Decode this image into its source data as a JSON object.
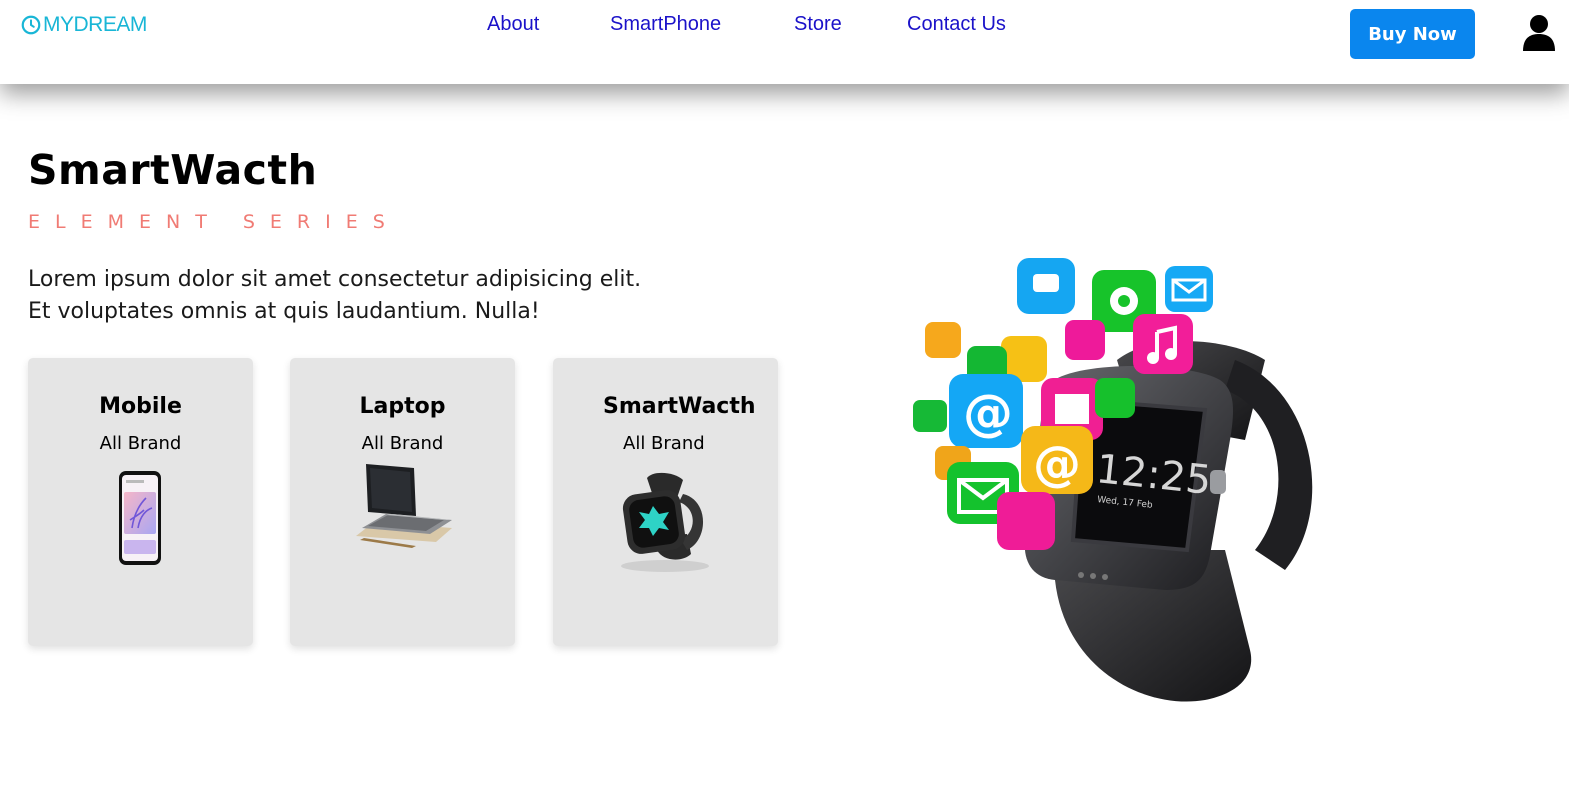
{
  "header": {
    "logo_text": "MYDREAM",
    "nav": [
      "About",
      "SmartPhone",
      "Store",
      "Contact Us"
    ],
    "buy_label": "Buy Now"
  },
  "hero": {
    "title": "SmartWacth",
    "subtitle": "ELEMENT SERIES",
    "text_line1": "Lorem ipsum dolor sit amet consectetur adipisicing elit.",
    "text_line2": "Et voluptates omnis at quis laudantium. Nulla!"
  },
  "categories": [
    {
      "title": "Mobile",
      "subtitle": "All Brand",
      "image": "phone"
    },
    {
      "title": "Laptop",
      "subtitle": "All Brand",
      "image": "laptop"
    },
    {
      "title": "SmartWacth",
      "subtitle": "All Brand",
      "image": "smartwatch"
    }
  ],
  "watch_screen": {
    "time": "12:25",
    "date": "Wed, 17 Feb"
  },
  "colors": {
    "brand": "#19b6d6",
    "nav": "#1b12c9",
    "button": "#0a86ee",
    "accent": "#f07b74",
    "card": "#e5e5e5"
  }
}
